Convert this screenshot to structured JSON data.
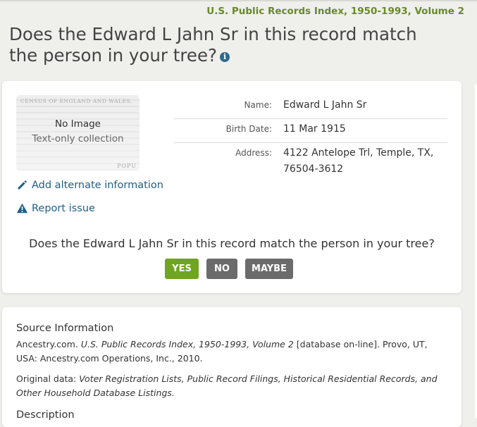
{
  "header": {
    "collection_title": "U.S. Public Records Index, 1950-1993, Volume 2",
    "question_title": "Does the Edward L Jahn Sr in this record match the person in your tree?",
    "info_icon": "info-icon"
  },
  "record": {
    "thumbnail": {
      "no_image": "No Image",
      "text_only": "Text-only collection",
      "census_text": "CENSUS OF ENGLAND AND WALES.",
      "popu_text": "POPU"
    },
    "fields": [
      {
        "label": "Name:",
        "value": "Edward L Jahn Sr"
      },
      {
        "label": "Birth Date:",
        "value": "11 Mar 1915"
      },
      {
        "label": "Address:",
        "value": "4122 Antelope Trl, Temple, TX, 76504-3612"
      }
    ],
    "actions": {
      "add_alternate": "Add alternate information",
      "report_issue": "Report issue"
    },
    "match_question": "Does the Edward L Jahn Sr in this record match the person in your tree?",
    "buttons": {
      "yes": "YES",
      "no": "NO",
      "maybe": "MAYBE"
    }
  },
  "source": {
    "heading": "Source Information",
    "citation_prefix": "Ancestry.com. ",
    "citation_title": "U.S. Public Records Index, 1950-1993, Volume 2",
    "citation_suffix": " [database on-line]. Provo, UT, USA: Ancestry.com Operations, Inc., 2010.",
    "original_prefix": "Original data: ",
    "original_text": "Voter Registration Lists, Public Record Filings, Historical Residential Records, and Other Household Database Listings.",
    "description_heading": "Description"
  },
  "colors": {
    "accent_green": "#6fa51f",
    "link_blue": "#1f5f85",
    "title_green": "#6a8a2a",
    "button_gray": "#6b6b6b"
  }
}
